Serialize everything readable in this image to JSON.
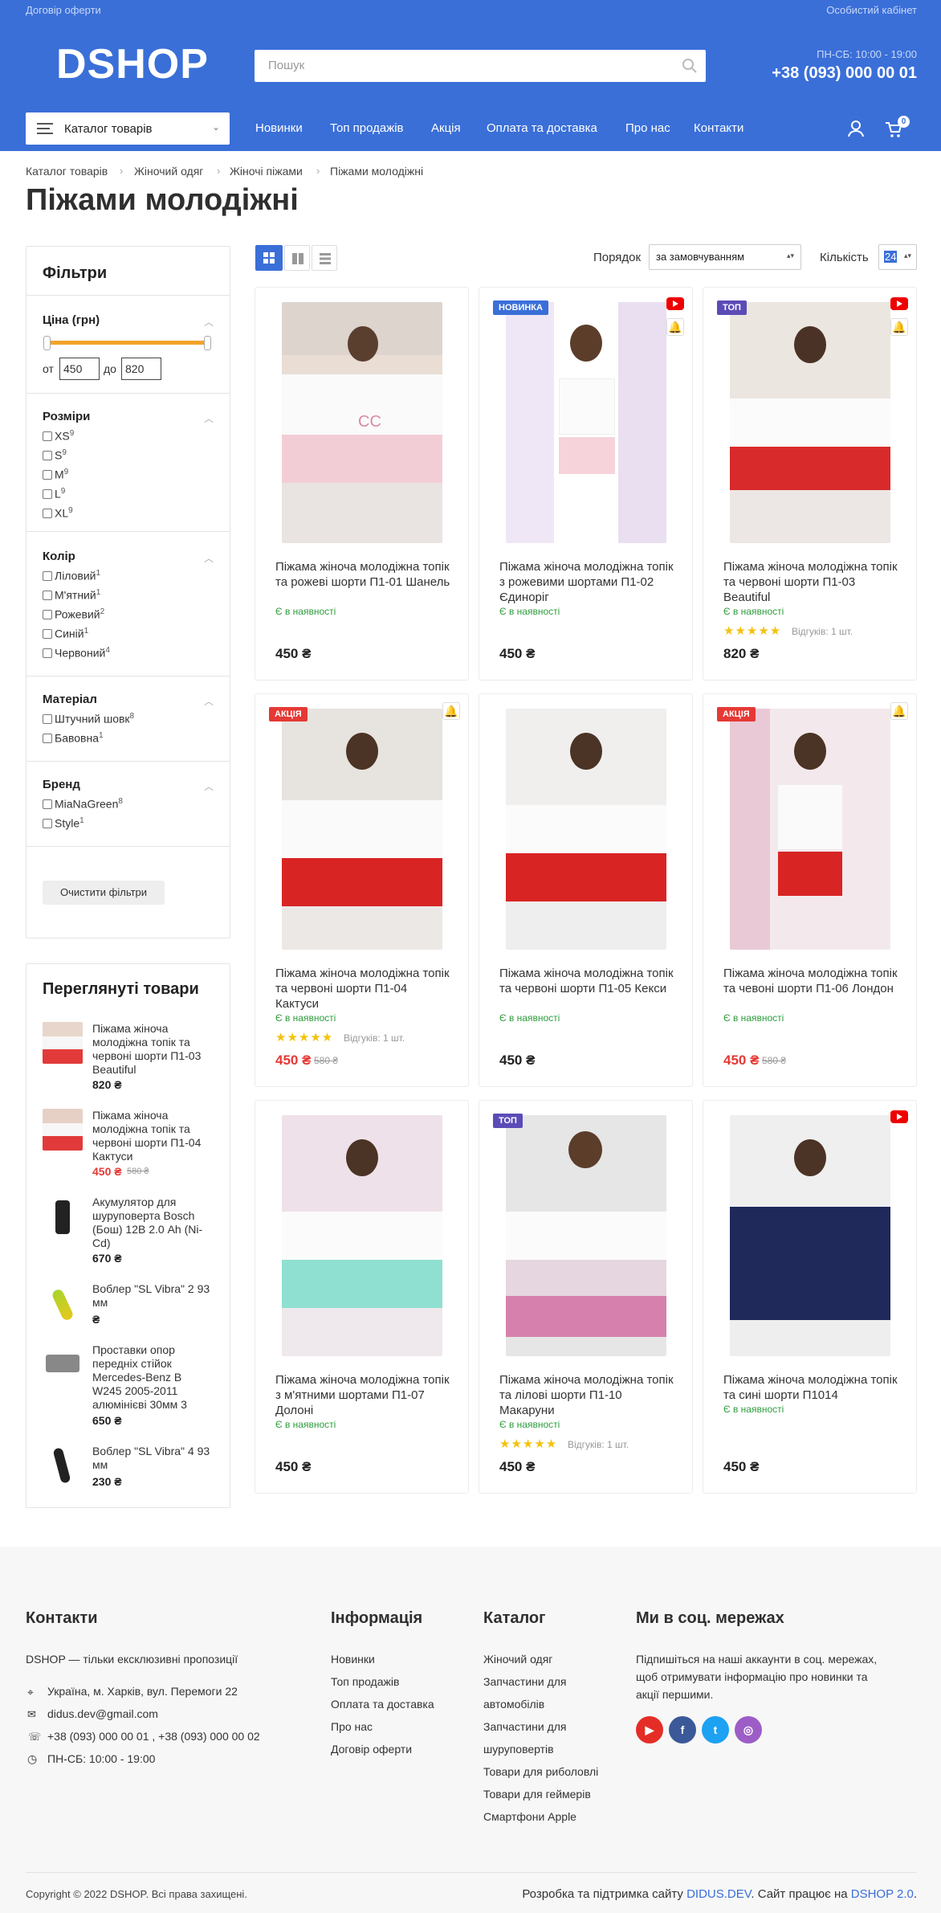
{
  "header": {
    "offer_link": "Договір оферти",
    "account_link": "Особистий кабінет",
    "logo": "DSHOP",
    "search_placeholder": "Пошук",
    "hours": "ПН-СБ: 10:00 - 19:00",
    "phone": "+38 (093) 000 00 01",
    "catalog_button": "Каталог товарів",
    "cart_count": "0",
    "nav": [
      "Новинки",
      "Топ продажів",
      "Акція",
      "Оплата та доставка",
      "Про нас",
      "Контакти"
    ]
  },
  "breadcrumb": [
    "Каталог товарів",
    "Жіночий одяг",
    "Жіночі піжами",
    "Піжами молодіжні"
  ],
  "page_title": "Піжами молодіжні",
  "filters": {
    "title": "Фільтри",
    "price": {
      "label": "Ціна (грн)",
      "from_label": "от",
      "from": "450",
      "to_label": "до",
      "to": "820"
    },
    "sizes": {
      "label": "Розміри",
      "items": [
        {
          "name": "XS",
          "count": "9"
        },
        {
          "name": "S",
          "count": "9"
        },
        {
          "name": "M",
          "count": "9"
        },
        {
          "name": "L",
          "count": "9"
        },
        {
          "name": "XL",
          "count": "9"
        }
      ]
    },
    "colors": {
      "label": "Колір",
      "items": [
        {
          "name": "Лiловий",
          "count": "1"
        },
        {
          "name": "М'ятний",
          "count": "1"
        },
        {
          "name": "Рожевий",
          "count": "2"
        },
        {
          "name": "Синій",
          "count": "1"
        },
        {
          "name": "Червоний",
          "count": "4"
        }
      ]
    },
    "material": {
      "label": "Матеріал",
      "items": [
        {
          "name": "Штучний шовк",
          "count": "8"
        },
        {
          "name": "Бавовна",
          "count": "1"
        }
      ]
    },
    "brand": {
      "label": "Бренд",
      "items": [
        {
          "name": "MiaNaGreen",
          "count": "8"
        },
        {
          "name": "Style",
          "count": "1"
        }
      ]
    },
    "clear_button": "Очистити фільтри"
  },
  "toolbar": {
    "order_label": "Порядок",
    "order_value": "за замовчуванням",
    "qty_label": "Кількість",
    "qty_value": "24"
  },
  "products": [
    {
      "title": "Піжама жіноча молодіжна топік та рожеві шорти П1-01 Шанель",
      "stock": "Є в наявності",
      "price": "450 ₴",
      "badge": "",
      "old_price": "",
      "reviews": ""
    },
    {
      "title": "Піжама жіноча молодіжна топік з рожевими шортами П1-02 Єдиноріг",
      "stock": "Є в наявності",
      "price": "450 ₴",
      "badge": "НОВИНКА",
      "old_price": "",
      "reviews": ""
    },
    {
      "title": "Піжама жіноча молодіжна топік та червоні шорти П1-03 Beautiful",
      "stock": "Є в наявності",
      "price": "820 ₴",
      "badge": "ТОП",
      "old_price": "",
      "reviews": "Відгуків: 1 шт."
    },
    {
      "title": "Піжама жіноча молодіжна топік та червоні шорти П1-04 Кактуси",
      "stock": "Є в наявності",
      "price": "450 ₴",
      "badge": "АКЦІЯ",
      "old_price": "580 ₴",
      "reviews": "Відгуків: 1 шт."
    },
    {
      "title": "Піжама жіноча молодіжна топік та червоні шорти П1-05 Кекси",
      "stock": "Є в наявності",
      "price": "450 ₴",
      "badge": "",
      "old_price": "",
      "reviews": ""
    },
    {
      "title": "Піжама жіноча молодіжна топік та чевоні шорти П1-06 Лондон",
      "stock": "Є в наявності",
      "price": "450 ₴",
      "badge": "АКЦІЯ",
      "old_price": "580 ₴",
      "reviews": ""
    },
    {
      "title": "Піжама жіноча молодіжна топік з м'ятними шортами П1-07 Долоні",
      "stock": "Є в наявності",
      "price": "450 ₴",
      "badge": "",
      "old_price": "",
      "reviews": ""
    },
    {
      "title": "Піжама жіноча молодіжна топік та лілові шорти П1-10 Макаруни",
      "stock": "Є в наявності",
      "price": "450 ₴",
      "badge": "ТОП",
      "old_price": "",
      "reviews": "Відгуків: 1 шт."
    },
    {
      "title": "Піжама жіноча молодіжна топік та сині шорти П1014",
      "stock": "Є в наявності",
      "price": "450 ₴",
      "badge": "",
      "old_price": "",
      "reviews": ""
    }
  ],
  "viewed": {
    "title": "Переглянуті товари",
    "items": [
      {
        "title": "Піжама жіноча молодіжна топік та червоні шорти П1-03 Beautiful",
        "price": "820 ₴",
        "old": ""
      },
      {
        "title": "Піжама жіноча молодіжна топік та червоні шорти П1-04 Кактуси",
        "price": "450 ₴",
        "old": "580 ₴"
      },
      {
        "title": "Акумулятор для шуруповерта Bosch (Бош) 12В 2.0 Ah (Ni-Cd)",
        "price": "670 ₴",
        "old": ""
      },
      {
        "title": "Воблер \"SL Vibra\" 2 93 мм",
        "price": "₴",
        "old": ""
      },
      {
        "title": "Проставки опор передніх стійок Mercedes-Benz B W245 2005-2011 алюмінієві 30мм 3",
        "price": "650 ₴",
        "old": ""
      },
      {
        "title": "Воблер \"SL Vibra\" 4 93 мм",
        "price": "230 ₴",
        "old": ""
      }
    ]
  },
  "footer": {
    "contacts": {
      "title": "Контакти",
      "tagline": "DSHOP — тільки ексклюзивні пропозиції",
      "address": "Україна, м. Харків, вул. Перемоги 22",
      "email": "didus.dev@gmail.com",
      "phones": "+38 (093) 000 00 01 , +38 (093) 000 00 02",
      "hours": "ПН-СБ: 10:00 - 19:00"
    },
    "info": {
      "title": "Інформація",
      "links": [
        "Новинки",
        "Топ продажів",
        "Оплата та доставка",
        "Про нас",
        "Договір оферти"
      ]
    },
    "catalog": {
      "title": "Каталог",
      "links": [
        "Жіночий одяг",
        "Запчастини для",
        "автомобілів",
        "Запчастини для",
        "шуруповертів",
        "Товари для риболовлі",
        "Товари для геймерів",
        "Смартфони Apple"
      ]
    },
    "social": {
      "title": "Ми в соц. мережах",
      "text": [
        "Підпишіться на наші аккаунти в соц. мережах,",
        "щоб отримувати інформацію про новинки та",
        "акції першими."
      ]
    },
    "copyright": "Copyright © 2022 DSHOP. Всі права захищені.",
    "dev_prefix": "Розробка та підтримка сайту ",
    "dev_link": "DIDUS.DEV",
    "dev_mid": ". Сайт працює на ",
    "dev_link2": "DSHOP 2.0",
    "dev_end": "."
  },
  "colors": {
    "primary": "#3a6fd8",
    "sale": "#e53935",
    "stock": "#2e9e3e",
    "badge_new": "#3a6fd8",
    "badge_top": "#5b4bb7",
    "badge_sale": "#e53935",
    "star": "#f4c20d"
  }
}
